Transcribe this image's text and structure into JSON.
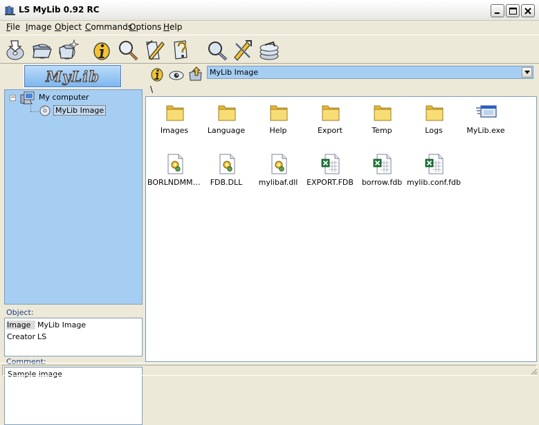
{
  "window": {
    "title": "LS MyLib 0.92 RC"
  },
  "menu": [
    {
      "label": "File"
    },
    {
      "label": "Image"
    },
    {
      "label": "Object"
    },
    {
      "label": "Commands"
    },
    {
      "label": "Options"
    },
    {
      "label": "Help"
    }
  ],
  "toolbar": {
    "icons": [
      "open-disc-icon",
      "open-folder-icon",
      "new-folder-icon",
      "info-icon",
      "search-magnifier-icon",
      "edit-tool-icon",
      "help-question-icon",
      "find-icon",
      "tools-icon",
      "disc-stack-icon"
    ]
  },
  "sidebar": {
    "logo_text": "MyLib",
    "tree": {
      "expander": "−",
      "root_label": "My computer",
      "child_label": "MyLib Image"
    },
    "object_panel": {
      "label": "Object:",
      "properties": [
        {
          "key": "Image",
          "value": "MyLib Image"
        },
        {
          "key": "Creator",
          "value": "LS"
        }
      ]
    },
    "comment_panel": {
      "label": "Comment:",
      "text": "Sample image"
    }
  },
  "browser": {
    "path_value": "MyLib Image",
    "current_path": "\\",
    "files": [
      {
        "name": "Images",
        "type": "folder"
      },
      {
        "name": "Language",
        "type": "folder"
      },
      {
        "name": "Help",
        "type": "folder"
      },
      {
        "name": "Export",
        "type": "folder"
      },
      {
        "name": "Temp",
        "type": "folder"
      },
      {
        "name": "Logs",
        "type": "folder"
      },
      {
        "name": "MyLib.exe",
        "type": "exe"
      },
      {
        "name": "BORLNDMM.DLL",
        "type": "dll"
      },
      {
        "name": "FDB.DLL",
        "type": "dll"
      },
      {
        "name": "mylibaf.dll",
        "type": "dll"
      },
      {
        "name": "EXPORT.FDB",
        "type": "fdb"
      },
      {
        "name": "borrow.fdb",
        "type": "fdb"
      },
      {
        "name": "mylib.conf.fdb",
        "type": "fdb"
      }
    ]
  },
  "colors": {
    "selection_blue": "#a6cef2",
    "chrome": "#ece9d8",
    "folder_yellow": "#f4d160",
    "excel_green": "#1e7a3c"
  }
}
